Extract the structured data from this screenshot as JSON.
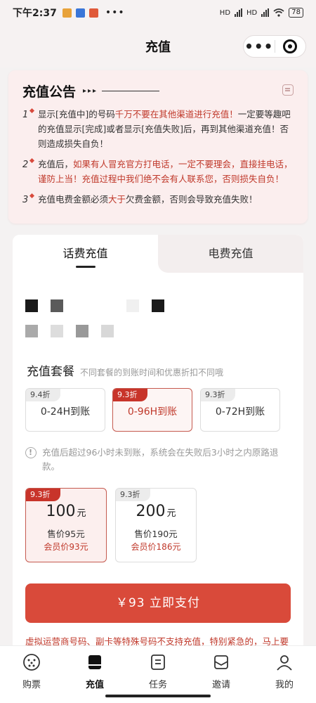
{
  "status_bar": {
    "time": "下午2:37",
    "dots": "•••",
    "battery": "78",
    "network": "HD"
  },
  "header": {
    "title": "充值",
    "more_label": "•••"
  },
  "notice": {
    "title": "充值公告",
    "arrows": "▸▸▸",
    "items": [
      {
        "num": "1",
        "t1": "显示[充值中]的号码",
        "t2": "千万不要在其他渠道进行充值！",
        "t3": "一定要等趣吧的充值显示[完成]或者显示[充值失败]后，再到其他渠道充值！否则造成损失自负！"
      },
      {
        "num": "2",
        "t1": "充值后，",
        "t2": "如果有人冒充官方打电话，一定不要理会，直接挂电话，谨防上当！充值过程中我们绝不会有人联系您，否则损失自负！",
        "t3": ""
      },
      {
        "num": "3",
        "t1": "充值电费金额必须",
        "t2": "大于",
        "t3": "欠费金额，否则会导致充值失败！"
      }
    ]
  },
  "tabs": {
    "phone": "话费充值",
    "electric": "电费充值"
  },
  "packages": {
    "title": "充值套餐",
    "subtitle": "不同套餐的到账时间和优惠折扣不同哦",
    "options": [
      {
        "tag": "9.4折",
        "label": "0-24H到账"
      },
      {
        "tag": "9.3折",
        "label": "0-96H到账"
      },
      {
        "tag": "9.3折",
        "label": "0-72H到账"
      }
    ],
    "tip": "充值后超过96小时未到账，系统会在失败后3小时之内原路退款。"
  },
  "amounts": [
    {
      "tag": "9.3折",
      "value": "100",
      "unit": "元",
      "sale": "售价95元",
      "member": "会员价93元"
    },
    {
      "tag": "9.3折",
      "value": "200",
      "unit": "元",
      "sale": "售价190元",
      "member": "会员价186元"
    }
  ],
  "pay_button": "￥93 立即支付",
  "warning": "虚拟运营商号码、副卡等特殊号码不支持充值，特别紧急的，马上要",
  "nav": {
    "items": [
      {
        "label": "购票"
      },
      {
        "label": "充值"
      },
      {
        "label": "任务"
      },
      {
        "label": "邀请"
      },
      {
        "label": "我的"
      }
    ]
  },
  "colors": {
    "accent": "#d94a3a",
    "accent_text": "#c0392b",
    "notice_bg": "#fbeeee"
  }
}
